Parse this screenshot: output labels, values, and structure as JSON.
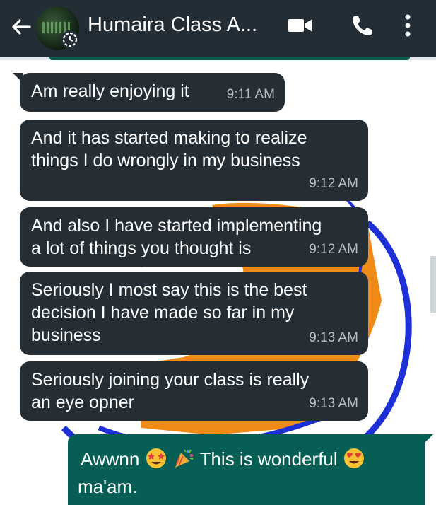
{
  "header": {
    "title": "Humaira Class A...",
    "icons": [
      "back-arrow-icon",
      "group-avatar",
      "clock-icon",
      "video-call-icon",
      "phone-icon",
      "more-vert-icon"
    ]
  },
  "colors": {
    "header_bg": "#232d36",
    "incoming_bubble": "#252e35",
    "outgoing_bubble": "#075e54",
    "timestamp": "#b8bfc4",
    "wallpaper_blue": "#1d2fd6",
    "wallpaper_orange": "#f08a17"
  },
  "messages": [
    {
      "text_lines": [
        "Am really enjoying it"
      ],
      "time": "9:11 AM"
    },
    {
      "text_lines": [
        "And it has started making to realize",
        "things I do wrongly in my business"
      ],
      "time": "9:12 AM"
    },
    {
      "text_lines": [
        "And also I have started implementing",
        "a lot of things you thought is"
      ],
      "time": "9:12 AM"
    },
    {
      "text_lines": [
        "Seriously I most say this is the best",
        "decision I have made so far in my",
        "business"
      ],
      "time": "9:13 AM"
    },
    {
      "text_lines": [
        "Seriously joining your class is really",
        "an eye opner"
      ],
      "time": "9:13 AM"
    }
  ],
  "outgoing": {
    "part1": "Awwnn",
    "part2": "This is wonderful",
    "line2": "ma'am.",
    "emojis": [
      "star-struck-emoji",
      "party-popper-emoji",
      "heart-eyes-emoji"
    ]
  }
}
